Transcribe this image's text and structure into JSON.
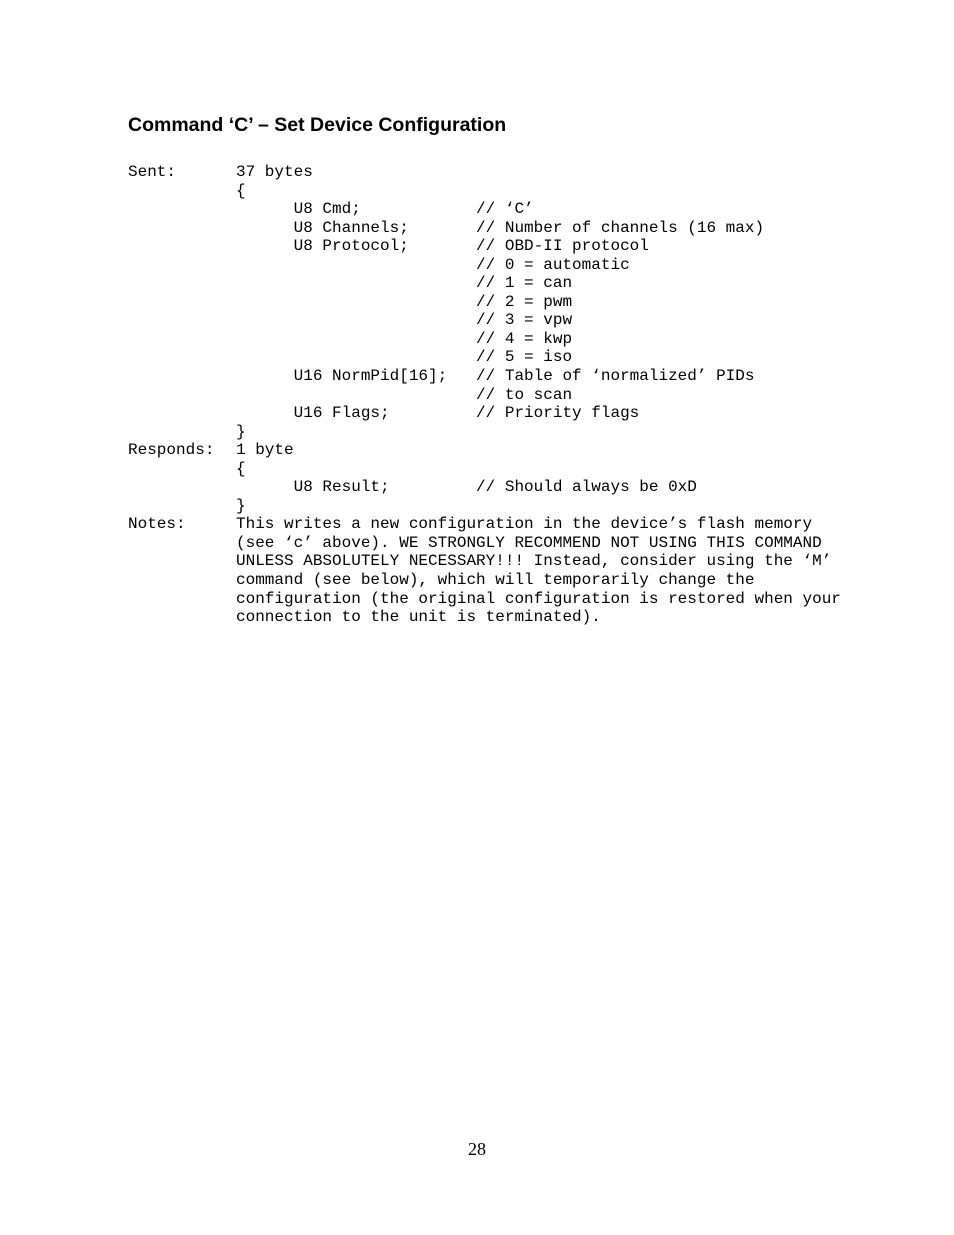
{
  "heading": "Command ‘C’ – Set Device Configuration",
  "labels": {
    "sent": "Sent:",
    "responds": "Responds:",
    "notes": "Notes:"
  },
  "sent_block": "37 bytes\n{\n      U8 Cmd;            // ‘C’\n      U8 Channels;       // Number of channels (16 max)\n      U8 Protocol;       // OBD-II protocol\n                         // 0 = automatic\n                         // 1 = can\n                         // 2 = pwm\n                         // 3 = vpw\n                         // 4 = kwp\n                         // 5 = iso\n      U16 NormPid[16];   // Table of ‘normalized’ PIDs\n                         // to scan\n      U16 Flags;         // Priority flags\n}",
  "responds_block": "1 byte\n{\n      U8 Result;         // Should always be 0xD\n}",
  "notes_text": "This writes a new configuration in the device’s flash memory (see ‘c’ above). WE STRONGLY RECOMMEND NOT USING THIS COMMAND UNLESS ABSOLUTELY NECESSARY!!! Instead, consider using the ‘M’ command (see below), which will temporarily change the configuration (the original configuration is restored when your connection to the unit is terminated).",
  "page_number": "28"
}
